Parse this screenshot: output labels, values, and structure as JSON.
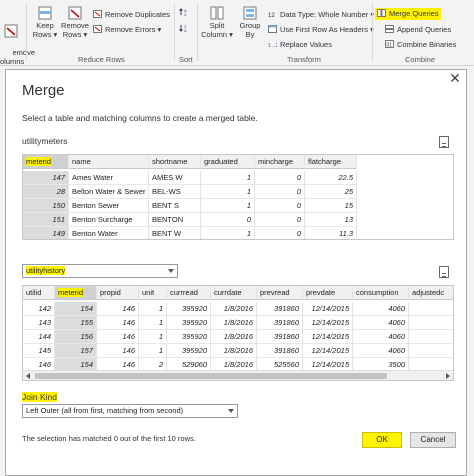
{
  "ribbon": {
    "remove_columns": "emove\nolumns",
    "keep_rows": "Keep\nRows ▾",
    "remove_rows": "Remove\nRows ▾",
    "remove_duplicates": "Remove Duplicates",
    "remove_errors": "Remove Errors ▾",
    "reduce_rows_label": "Reduce Rows",
    "sort_label": "Sort",
    "split_column": "Split\nColumn ▾",
    "group_by": "Group\nBy",
    "data_type": "Data Type: Whole Number ▾",
    "first_row_headers": "Use First Row As Headers ▾",
    "replace_values": "Replace Values",
    "transform_label": "Transform",
    "merge_queries": "Merge Queries",
    "append_queries": "Append Queries",
    "combine_binaries": "Combine Binaries",
    "combine_label": "Combine",
    "highlight_color": "#fff200"
  },
  "dialog": {
    "close": "✕",
    "title": "Merge",
    "subtitle": "Select a table and matching columns to create a merged table.",
    "table1_name": "utilitymeters",
    "table1_columns": [
      "meterid",
      "name",
      "shortname",
      "graduated",
      "mincharge",
      "flatcharge"
    ],
    "table1_rows": [
      [
        "147",
        "Ames Water",
        "AMES W",
        "1",
        "0",
        "22.5"
      ],
      [
        "28",
        "Belton Water & Sewer",
        "BEL-WS",
        "1",
        "0",
        "25"
      ],
      [
        "150",
        "Benton Sewer",
        "BENT S",
        "1",
        "0",
        "15"
      ],
      [
        "151",
        "Benton Surcharge",
        "BENTON",
        "0",
        "0",
        "13"
      ],
      [
        "149",
        "Benton Water",
        "BENT W",
        "1",
        "0",
        "11.3"
      ]
    ],
    "table2_name": "utilityhistory",
    "table2_columns": [
      "utilid",
      "meterid",
      "propid",
      "unit",
      "currread",
      "currdate",
      "prevread",
      "prevdate",
      "consumption",
      "adjustedc"
    ],
    "table2_rows": [
      [
        "142",
        "154",
        "146",
        "1",
        "395920",
        "1/8/2016",
        "391860",
        "12/14/2015",
        "4060",
        ""
      ],
      [
        "143",
        "155",
        "146",
        "1",
        "395920",
        "1/8/2016",
        "391860",
        "12/14/2015",
        "4060",
        ""
      ],
      [
        "144",
        "156",
        "146",
        "1",
        "395920",
        "1/8/2016",
        "391860",
        "12/14/2015",
        "4060",
        ""
      ],
      [
        "145",
        "157",
        "146",
        "1",
        "395920",
        "1/8/2016",
        "391860",
        "12/14/2015",
        "4060",
        ""
      ],
      [
        "146",
        "154",
        "146",
        "2",
        "529060",
        "1/8/2016",
        "525560",
        "12/14/2015",
        "3500",
        ""
      ]
    ],
    "join_kind_label": "Join Kind",
    "join_kind_value": "Left Outer (all from first, matching from second)",
    "status": "The selection has matched 0 out of the first 10 rows.",
    "ok_label": "OK",
    "cancel_label": "Cancel"
  }
}
